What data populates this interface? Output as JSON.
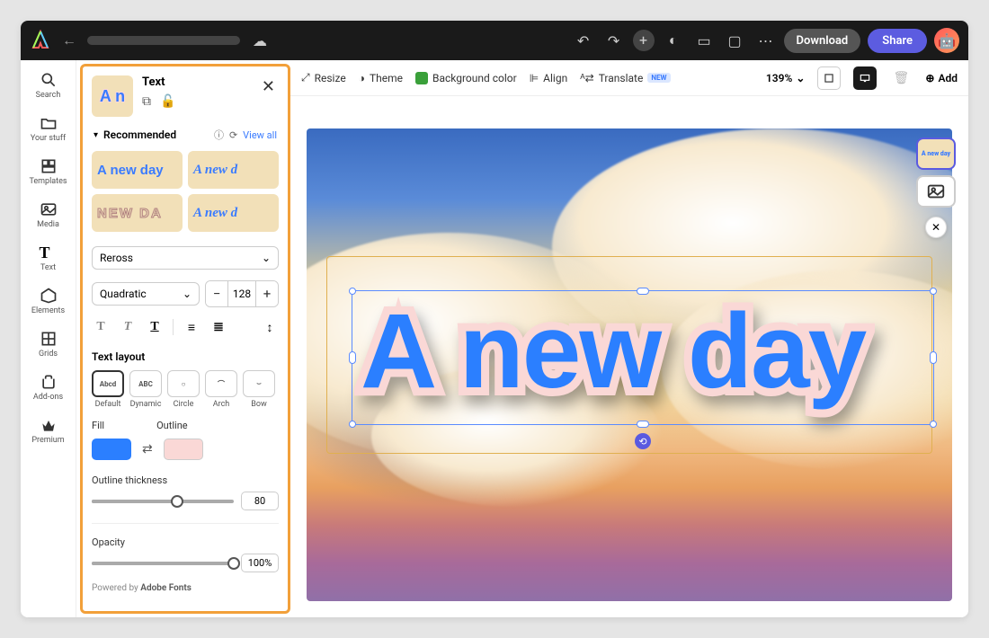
{
  "topbar": {
    "download_label": "Download",
    "share_label": "Share"
  },
  "rail": {
    "items": [
      {
        "label": "Search"
      },
      {
        "label": "Your stuff"
      },
      {
        "label": "Templates"
      },
      {
        "label": "Media"
      },
      {
        "label": "Text"
      },
      {
        "label": "Elements"
      },
      {
        "label": "Grids"
      },
      {
        "label": "Add-ons"
      },
      {
        "label": "Premium"
      }
    ]
  },
  "panel": {
    "title": "Text",
    "thumb_text": "A n",
    "recommended_label": "Recommended",
    "view_all_label": "View all",
    "style_tiles": [
      "A new day",
      "A new d",
      "NEW  DA",
      "A new d"
    ],
    "font_name": "Reross",
    "style_name": "Quadratic",
    "font_size": "128",
    "text_layout_label": "Text layout",
    "layouts": [
      {
        "name": "Default",
        "glyph": "Abcd"
      },
      {
        "name": "Dynamic",
        "glyph": "ABC"
      },
      {
        "name": "Circle",
        "glyph": "○"
      },
      {
        "name": "Arch",
        "glyph": "⌒"
      },
      {
        "name": "Bow",
        "glyph": "⌣"
      }
    ],
    "fill_label": "Fill",
    "outline_label": "Outline",
    "fill_color": "#2b7fff",
    "outline_color": "#fad8d6",
    "outline_thickness_label": "Outline thickness",
    "outline_thickness_value": "80",
    "opacity_label": "Opacity",
    "opacity_value": "100%",
    "powered_prefix": "Powered by ",
    "powered_brand": "Adobe Fonts"
  },
  "toolbar": {
    "resize": "Resize",
    "theme": "Theme",
    "bgcolor": "Background color",
    "align": "Align",
    "translate": "Translate",
    "translate_badge": "NEW",
    "zoom": "139%",
    "add": "Add"
  },
  "canvas": {
    "main_text": "A new day",
    "mini_thumb_text": "A new day"
  }
}
